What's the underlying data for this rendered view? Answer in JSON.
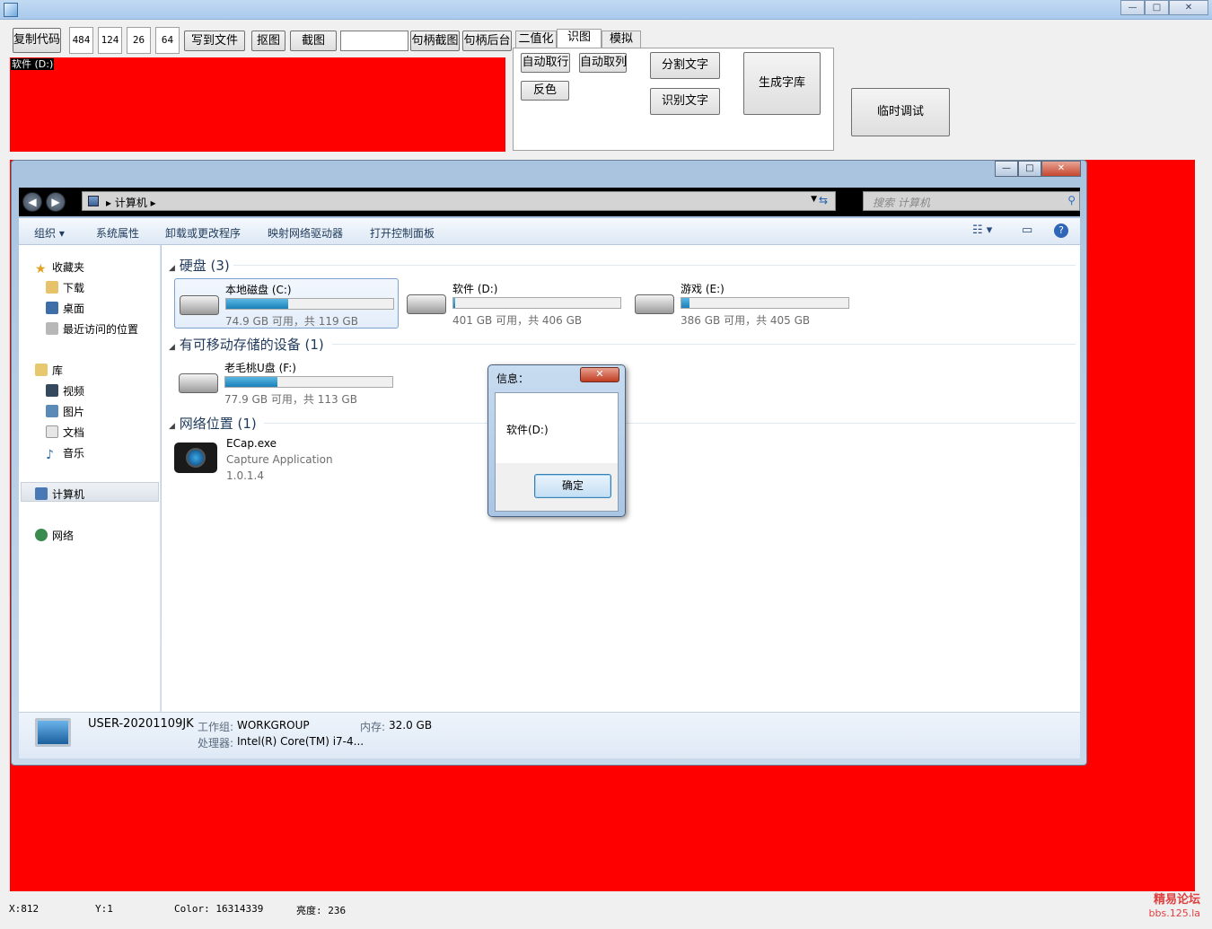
{
  "toolbar": {
    "copy_code": "复制代码",
    "num1": "484",
    "num2": "124",
    "num3": "26",
    "num4": "64",
    "write_file": "写到文件",
    "cutout": "抠图",
    "screenshot": "截图",
    "handle_screenshot": "句柄截图",
    "handle_background": "句柄后台"
  },
  "preview": {
    "label": "软件 (D:)"
  },
  "tabs": [
    {
      "label": "二值化"
    },
    {
      "label": "识图"
    },
    {
      "label": "模拟"
    }
  ],
  "tab_panel": {
    "auto_row": "自动取行",
    "auto_col": "自动取列",
    "invert": "反色",
    "split_text": "分割文字",
    "recognize_text": "识别文字",
    "gen_font": "生成字库"
  },
  "temp_debug": "临时调试",
  "explorer": {
    "breadcrumb": "计算机",
    "search_placeholder": "搜索 计算机",
    "commands": [
      "组织 ▾",
      "系统属性",
      "卸载或更改程序",
      "映射网络驱动器",
      "打开控制面板"
    ],
    "nav": {
      "favorites": "收藏夹",
      "downloads": "下载",
      "desktop": "桌面",
      "recent": "最近访问的位置",
      "libraries": "库",
      "videos": "视频",
      "pictures": "图片",
      "documents": "文档",
      "music": "音乐",
      "computer": "计算机",
      "network": "网络"
    },
    "groups": {
      "hdd": "硬盘 (3)",
      "removable": "有可移动存储的设备 (1)",
      "network": "网络位置 (1)"
    },
    "drives": [
      {
        "name": "本地磁盘 (C:)",
        "info": "74.9 GB 可用，共 119 GB",
        "used": 0.37
      },
      {
        "name": "软件 (D:)",
        "info": "401 GB 可用，共 406 GB",
        "used": 0.01
      },
      {
        "name": "游戏 (E:)",
        "info": "386 GB 可用，共 405 GB",
        "used": 0.05
      },
      {
        "name": "老毛桃U盘 (F:)",
        "info": "77.9 GB 可用，共 113 GB",
        "used": 0.31
      }
    ],
    "app": {
      "name": "ECap.exe",
      "desc": "Capture Application",
      "version": "1.0.1.4"
    },
    "details": {
      "computer_name": "USER-20201109JK",
      "workgroup_label": "工作组:",
      "workgroup": "WORKGROUP",
      "memory_label": "内存:",
      "memory": "32.0 GB",
      "cpu_label": "处理器:",
      "cpu": "Intel(R) Core(TM) i7-4..."
    }
  },
  "msgbox": {
    "title": "信息：",
    "text": "软件(D:)",
    "ok": "确定"
  },
  "status": {
    "x": "X:812",
    "y": "Y:1",
    "color": "Color: 16314339",
    "brightness": "亮度: 236"
  },
  "watermark": {
    "line1": "精易论坛",
    "line2": "bbs.125.la"
  },
  "colors": {
    "highlight": "#ff0000"
  }
}
